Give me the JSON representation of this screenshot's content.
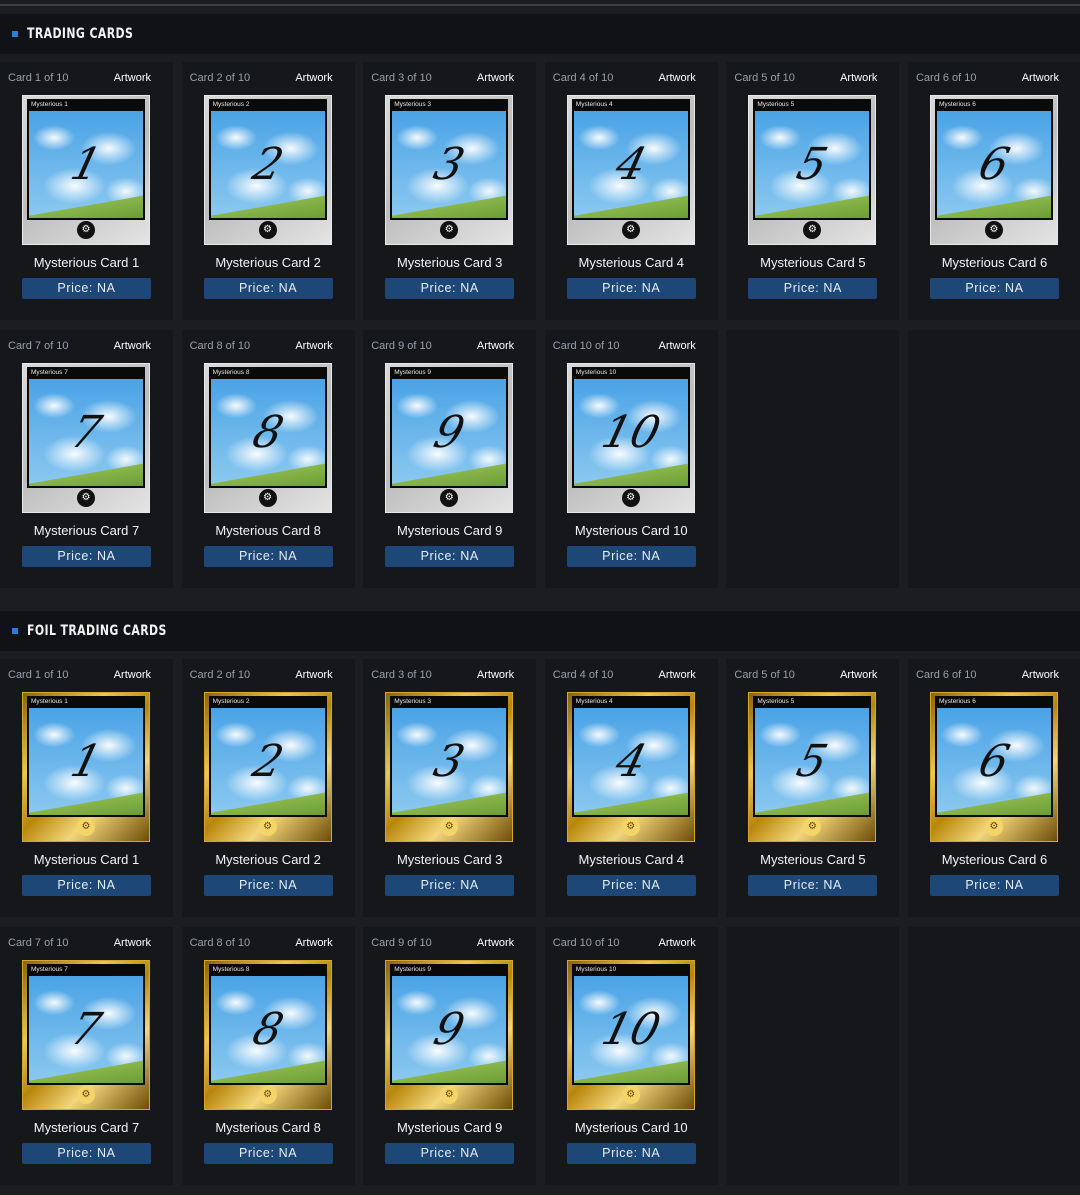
{
  "sections": [
    {
      "title": "TRADING CARDS",
      "foil": false,
      "cards": [
        {
          "count": "Card 1 of 10",
          "artwork": "Artwork",
          "tag": "Mysterious 1",
          "num": "1",
          "name": "Mysterious Card 1",
          "price": "Price: NA"
        },
        {
          "count": "Card 2 of 10",
          "artwork": "Artwork",
          "tag": "Mysterious 2",
          "num": "2",
          "name": "Mysterious Card 2",
          "price": "Price: NA"
        },
        {
          "count": "Card 3 of 10",
          "artwork": "Artwork",
          "tag": "Mysterious 3",
          "num": "3",
          "name": "Mysterious Card 3",
          "price": "Price: NA"
        },
        {
          "count": "Card 4 of 10",
          "artwork": "Artwork",
          "tag": "Mysterious 4",
          "num": "4",
          "name": "Mysterious Card 4",
          "price": "Price: NA"
        },
        {
          "count": "Card 5 of 10",
          "artwork": "Artwork",
          "tag": "Mysterious 5",
          "num": "5",
          "name": "Mysterious Card 5",
          "price": "Price: NA"
        },
        {
          "count": "Card 6 of 10",
          "artwork": "Artwork",
          "tag": "Mysterious 6",
          "num": "6",
          "name": "Mysterious Card 6",
          "price": "Price: NA"
        },
        {
          "count": "Card 7 of 10",
          "artwork": "Artwork",
          "tag": "Mysterious 7",
          "num": "7",
          "name": "Mysterious Card 7",
          "price": "Price: NA"
        },
        {
          "count": "Card 8 of 10",
          "artwork": "Artwork",
          "tag": "Mysterious 8",
          "num": "8",
          "name": "Mysterious Card 8",
          "price": "Price: NA"
        },
        {
          "count": "Card 9 of 10",
          "artwork": "Artwork",
          "tag": "Mysterious 9",
          "num": "9",
          "name": "Mysterious Card 9",
          "price": "Price: NA"
        },
        {
          "count": "Card 10 of 10",
          "artwork": "Artwork",
          "tag": "Mysterious 10",
          "num": "10",
          "name": "Mysterious Card 10",
          "price": "Price: NA"
        }
      ]
    },
    {
      "title": "FOIL TRADING CARDS",
      "foil": true,
      "cards": [
        {
          "count": "Card 1 of 10",
          "artwork": "Artwork",
          "tag": "Mysterious 1",
          "num": "1",
          "name": "Mysterious Card 1",
          "price": "Price: NA"
        },
        {
          "count": "Card 2 of 10",
          "artwork": "Artwork",
          "tag": "Mysterious 2",
          "num": "2",
          "name": "Mysterious Card 2",
          "price": "Price: NA"
        },
        {
          "count": "Card 3 of 10",
          "artwork": "Artwork",
          "tag": "Mysterious 3",
          "num": "3",
          "name": "Mysterious Card 3",
          "price": "Price: NA"
        },
        {
          "count": "Card 4 of 10",
          "artwork": "Artwork",
          "tag": "Mysterious 4",
          "num": "4",
          "name": "Mysterious Card 4",
          "price": "Price: NA"
        },
        {
          "count": "Card 5 of 10",
          "artwork": "Artwork",
          "tag": "Mysterious 5",
          "num": "5",
          "name": "Mysterious Card 5",
          "price": "Price: NA"
        },
        {
          "count": "Card 6 of 10",
          "artwork": "Artwork",
          "tag": "Mysterious 6",
          "num": "6",
          "name": "Mysterious Card 6",
          "price": "Price: NA"
        },
        {
          "count": "Card 7 of 10",
          "artwork": "Artwork",
          "tag": "Mysterious 7",
          "num": "7",
          "name": "Mysterious Card 7",
          "price": "Price: NA"
        },
        {
          "count": "Card 8 of 10",
          "artwork": "Artwork",
          "tag": "Mysterious 8",
          "num": "8",
          "name": "Mysterious Card 8",
          "price": "Price: NA"
        },
        {
          "count": "Card 9 of 10",
          "artwork": "Artwork",
          "tag": "Mysterious 9",
          "num": "9",
          "name": "Mysterious Card 9",
          "price": "Price: NA"
        },
        {
          "count": "Card 10 of 10",
          "artwork": "Artwork",
          "tag": "Mysterious 10",
          "num": "10",
          "name": "Mysterious Card 10",
          "price": "Price: NA"
        }
      ]
    }
  ],
  "icons": {
    "card_logo": "steam-logo-icon",
    "section_bullet": "square-bullet-icon"
  },
  "colors": {
    "accent": "#2e7bd6",
    "price_button": "#1d4777",
    "background": "#1b1d21",
    "cell": "#15171b"
  }
}
